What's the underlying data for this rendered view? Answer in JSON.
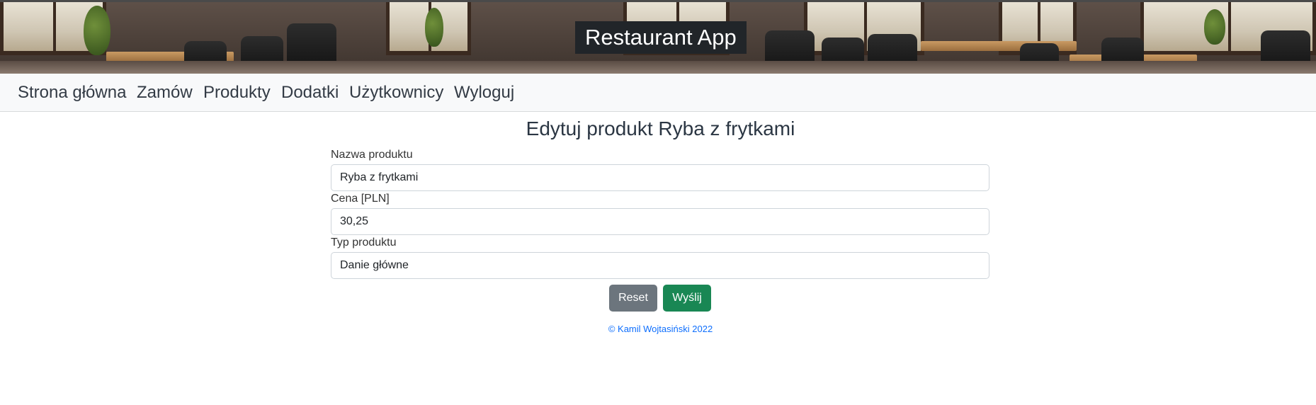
{
  "header": {
    "app_title": "Restaurant App"
  },
  "nav": {
    "items": [
      {
        "label": "Strona główna"
      },
      {
        "label": "Zamów"
      },
      {
        "label": "Produkty"
      },
      {
        "label": "Dodatki"
      },
      {
        "label": "Użytkownicy"
      },
      {
        "label": "Wyloguj"
      }
    ]
  },
  "form": {
    "title": "Edytuj produkt Ryba z frytkami",
    "name_label": "Nazwa produktu",
    "name_value": "Ryba z frytkami",
    "price_label": "Cena [PLN]",
    "price_value": "30,25",
    "type_label": "Typ produktu",
    "type_value": "Danie główne",
    "reset_label": "Reset",
    "submit_label": "Wyślij"
  },
  "footer": {
    "copyright": "© Kamil Wojtasiński 2022",
    "link_color": "#0d6efd"
  },
  "colors": {
    "title_bg": "#212529",
    "reset_button": "#6c757d",
    "submit_button": "#198754"
  }
}
